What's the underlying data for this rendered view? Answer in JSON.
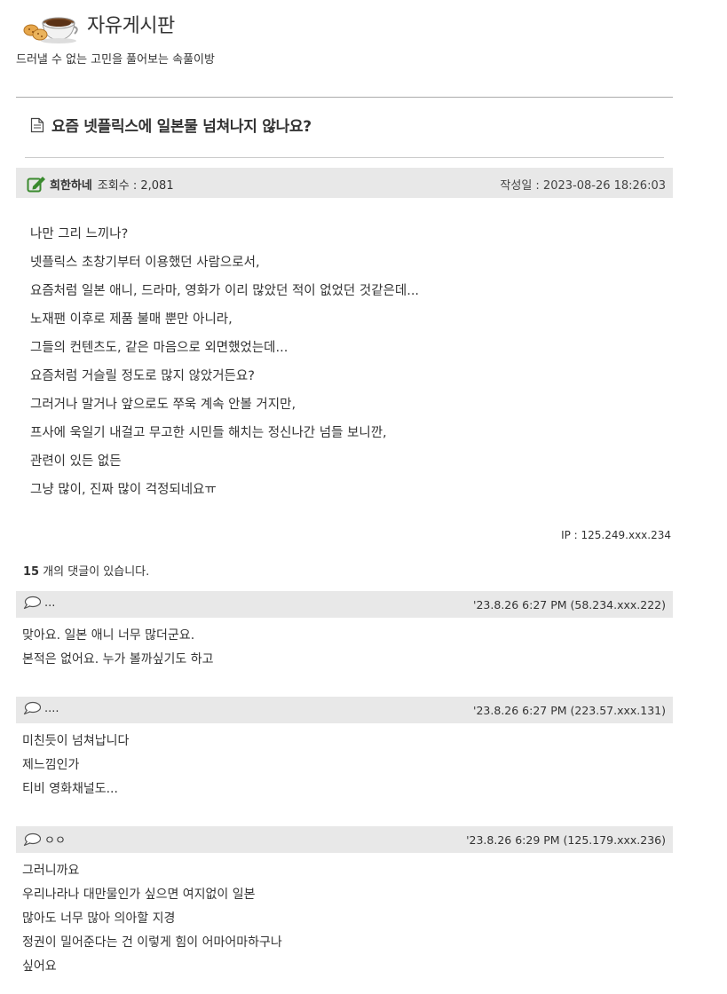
{
  "board": {
    "title": "자유게시판",
    "description": "드러낼 수 없는 고민을 풀어보는 속풀이방"
  },
  "post": {
    "title": "요즘 넷플릭스에 일본물 넘쳐나지 않나요?",
    "author": "희한하네",
    "views_label": "조회수 : 2,081",
    "date_label": "작성일 : 2023-08-26 18:26:03",
    "body": [
      "나만 그리 느끼나?",
      "넷플릭스 초창기부터 이용했던 사람으로서,",
      "요즘처럼 일본 애니, 드라마, 영화가 이리 많았던 적이 없었던 것같은데...",
      "노재팬 이후로 제품 불매 뿐만 아니라,",
      "그들의 컨텐츠도, 같은 마음으로 외면했었는데...",
      "요즘처럼 거슬릴 정도로 많지 않았거든요?",
      "그러거나 말거나 앞으로도 쭈욱 계속 안볼 거지만,",
      "프사에 욱일기 내걸고 무고한 시민들 해치는 정신나간 넘들 보니깐,",
      "관련이 있든 없든",
      "그냥 많이, 진짜 많이 걱정되네요ㅠ"
    ],
    "ip": "IP : 125.249.xxx.234"
  },
  "comments_summary": {
    "count": "15",
    "label": " 개의 댓글이 있습니다."
  },
  "comments": [
    {
      "author": "...",
      "meta": "'23.8.26 6:27 PM (58.234.xxx.222)",
      "lines": [
        "맞아요. 일본 애니 너무 많더군요.",
        "본적은 없어요. 누가 볼까싶기도 하고"
      ]
    },
    {
      "author": "....",
      "meta": "'23.8.26 6:27 PM (223.57.xxx.131)",
      "lines": [
        "미친듯이 넘쳐납니다",
        "제느낌인가",
        "티비 영화채널도..."
      ]
    },
    {
      "author": "ㅇㅇ",
      "meta": "'23.8.26 6:29 PM (125.179.xxx.236)",
      "lines": [
        "그러니까요",
        "우리나라나 대만물인가 싶으면 여지없이 일본",
        "많아도 너무 많아 의아할 지경",
        "정권이 밀어준다는 건 이렇게 힘이 어마어마하구나",
        "싶어요"
      ]
    }
  ],
  "icons": {
    "logo": "coffee-cup-cookies-icon",
    "title": "document-icon",
    "author": "pen-edit-icon",
    "comment": "speech-bubble-icon"
  },
  "colors": {
    "meta_bar": "#e8e8e8",
    "pen_icon": "#3a8a2e",
    "text": "#333333"
  }
}
